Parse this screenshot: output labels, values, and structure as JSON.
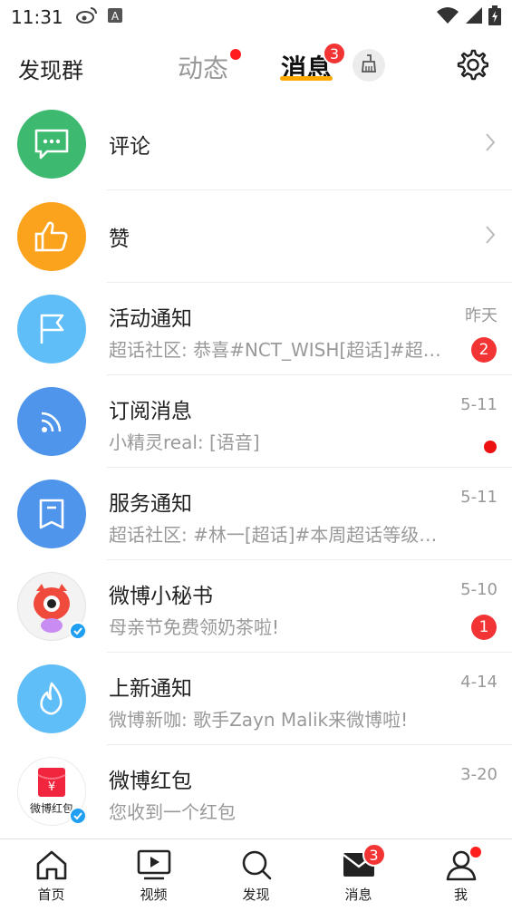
{
  "status_bar": {
    "time": "11:31",
    "left_icons": [
      "weibo-icon",
      "a-notification-icon"
    ],
    "right_icons": [
      "wifi-icon",
      "signal-icon",
      "battery-icon"
    ]
  },
  "header": {
    "discover_group": "发现群",
    "tabs": [
      {
        "label": "动态",
        "has_dot": true
      },
      {
        "label": "消息",
        "badge": "3",
        "active": true
      }
    ],
    "clean_icon": "broom-icon",
    "settings_icon": "gear-icon",
    "accent_color": "#ffa800"
  },
  "messages": [
    {
      "id": "comments",
      "title": "评论",
      "icon": "comment-icon",
      "color": "#3dba6f",
      "chevron": true
    },
    {
      "id": "likes",
      "title": "赞",
      "icon": "thumbs-up-icon",
      "color": "#fba31d",
      "chevron": true
    },
    {
      "id": "activity",
      "title": "活动通知",
      "subtitle": "超话社区: 恭喜#NCT_WISH[超话]#超话社区入驻",
      "time": "昨天",
      "badge": "2",
      "icon": "flag-icon",
      "color": "#5fbdf7"
    },
    {
      "id": "subscription",
      "title": "订阅消息",
      "subtitle": "小精灵real: [语音]",
      "time": "5-11",
      "dot": true,
      "icon": "rss-icon",
      "color": "#4f95ec"
    },
    {
      "id": "service",
      "title": "服务通知",
      "subtitle": "超话社区: #林一[超话]#本周超话等级提升",
      "time": "5-11",
      "icon": "bookmark-icon",
      "color": "#4f95ec"
    },
    {
      "id": "secretary",
      "title": "微博小秘书",
      "subtitle": "母亲节免费领奶茶啦!",
      "time": "5-10",
      "badge": "1",
      "icon": "weibo-mascot-icon",
      "verified": true
    },
    {
      "id": "new_arrival",
      "title": "上新通知",
      "subtitle": "微博新咖: 歌手Zayn Malik来微博啦!",
      "time": "4-14",
      "icon": "flame-icon",
      "color": "#5fbdf7"
    },
    {
      "id": "red_packet",
      "title": "微博红包",
      "subtitle": "您收到一个红包",
      "time": "3-20",
      "icon": "red-packet-icon",
      "logo_text": "微博红包",
      "verified": true
    }
  ],
  "bottom_nav": [
    {
      "label": "首页",
      "icon": "home-icon"
    },
    {
      "label": "视频",
      "icon": "video-icon"
    },
    {
      "label": "发现",
      "icon": "search-icon"
    },
    {
      "label": "消息",
      "icon": "mail-icon",
      "badge": "3"
    },
    {
      "label": "我",
      "icon": "profile-icon",
      "dot": true
    }
  ]
}
